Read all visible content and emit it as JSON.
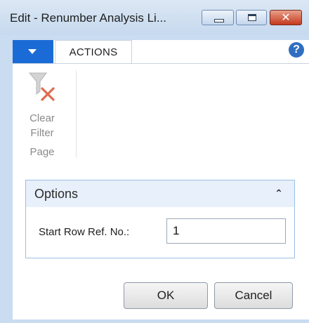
{
  "window": {
    "title": "Edit - Renumber Analysis Li...",
    "controls": {
      "minimize": "minimize-icon",
      "maximize": "maximize-icon",
      "close": "close-icon",
      "close_glyph": "✕"
    }
  },
  "ribbon": {
    "menu_icon": "dropdown-arrow-icon",
    "tabs": [
      {
        "label": "ACTIONS"
      }
    ],
    "help_glyph": "?",
    "groups": [
      {
        "label": "Page",
        "actions": [
          {
            "label": "Clear\nFilter",
            "icon": "clear-filter-icon",
            "enabled": false
          }
        ]
      }
    ]
  },
  "options": {
    "title": "Options",
    "collapse_glyph": "⌃",
    "fields": [
      {
        "label": "Start Row Ref. No.:",
        "value": "1"
      }
    ]
  },
  "buttons": {
    "ok": "OK",
    "cancel": "Cancel"
  },
  "colors": {
    "accent": "#1b6bd6",
    "frame": "#c9dcf0",
    "close": "#c4391e",
    "disabled_text": "#8a8a8a"
  }
}
